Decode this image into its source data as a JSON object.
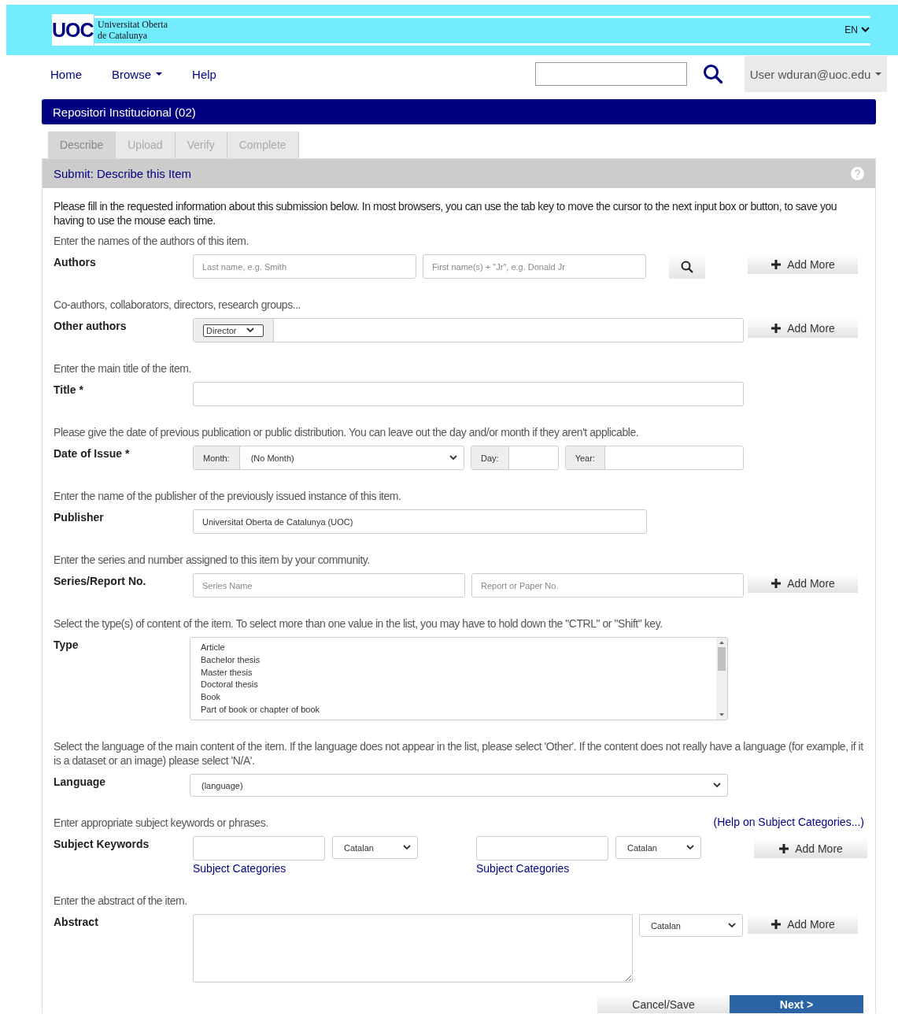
{
  "header": {
    "logo": "UOC",
    "institution_lines": [
      "Universitat Oberta",
      "de Catalunya"
    ],
    "language": "EN"
  },
  "nav": {
    "links": [
      {
        "label": "Home",
        "dropdown": false
      },
      {
        "label": "Browse",
        "dropdown": true
      },
      {
        "label": "Help",
        "dropdown": false
      }
    ],
    "user": "User wduran@uoc.edu"
  },
  "banner": "Repositori Institucional (02)",
  "tabs": [
    {
      "label": "Describe",
      "selected": true
    },
    {
      "label": "Upload",
      "selected": false
    },
    {
      "label": "Verify",
      "selected": false
    },
    {
      "label": "Complete",
      "selected": false
    }
  ],
  "panel": {
    "title": "Submit: Describe this Item",
    "intro": "Please fill in the requested information about this submission below. In most browsers, you can use the tab key to move the cursor to the next input box or button, to save you having to use the mouse each time."
  },
  "fields": [
    {
      "kind": "name_pair",
      "hint": "Enter the names of the authors of this item.",
      "label": "Authors",
      "placeholders": [
        "Last name, e.g. Smith",
        "First name(s) + \"Jr\", e.g. Donald Jr"
      ],
      "add_more": "Add More"
    },
    {
      "kind": "typed",
      "hint": "Co-authors, collaborators, directors, research groups...",
      "label": "Other authors",
      "type_value": "Director",
      "add_more": "Add More"
    },
    {
      "kind": "wide_text",
      "hint": "Enter the main title of the item.",
      "label": "Title *"
    },
    {
      "kind": "date",
      "hint": "Please give the date of previous publication or public distribution. You can leave out the day and/or month if they aren't applicable.",
      "label": "Date of Issue *",
      "month_label": "Month:",
      "month_value": "(No Month)",
      "day_label": "Day:",
      "year_label": "Year:"
    },
    {
      "kind": "text",
      "hint": "Enter the name of the publisher of the previously issued instance of this item.",
      "label": "Publisher",
      "value": "Universitat Oberta de Catalunya (UOC)"
    },
    {
      "kind": "series",
      "hint": "Enter the series and number assigned to this item by your community.",
      "label": "Series/Report No.",
      "placeholders": [
        "Series Name",
        "Report or Paper No."
      ],
      "add_more": "Add More"
    },
    {
      "kind": "list",
      "hint": "Select the type(s) of content of the item. To select more than one value in the list, you may have to hold down the \"CTRL\" or \"Shift\" key.",
      "label": "Type",
      "options": [
        "Article",
        "Bachelor thesis",
        "Master thesis",
        "Doctoral thesis",
        "Book",
        "Part of book or chapter of book"
      ]
    },
    {
      "kind": "select",
      "hint": "Select the language of the main content of the item. If the language does not appear in the list, please select 'Other'. If the content does not really have a language (for example, if it is a dataset or an image) please select 'N/A'.",
      "label": "Language",
      "value": "(language)"
    },
    {
      "kind": "subject",
      "hint": "Enter appropriate subject keywords or phrases.",
      "help_link": "(Help on Subject Categories...)",
      "label": "Subject Keywords",
      "groups": [
        {
          "language": "Catalan",
          "link": "Subject Categories"
        },
        {
          "language": "Catalan",
          "link": "Subject Categories"
        }
      ],
      "add_more": "Add More"
    },
    {
      "kind": "textarea",
      "hint": "Enter the abstract of the item.",
      "label": "Abstract",
      "language": "Catalan",
      "add_more": "Add More"
    }
  ],
  "actions": [
    {
      "label": "Cancel/Save",
      "primary": false
    },
    {
      "label": "Next >",
      "primary": true
    }
  ]
}
